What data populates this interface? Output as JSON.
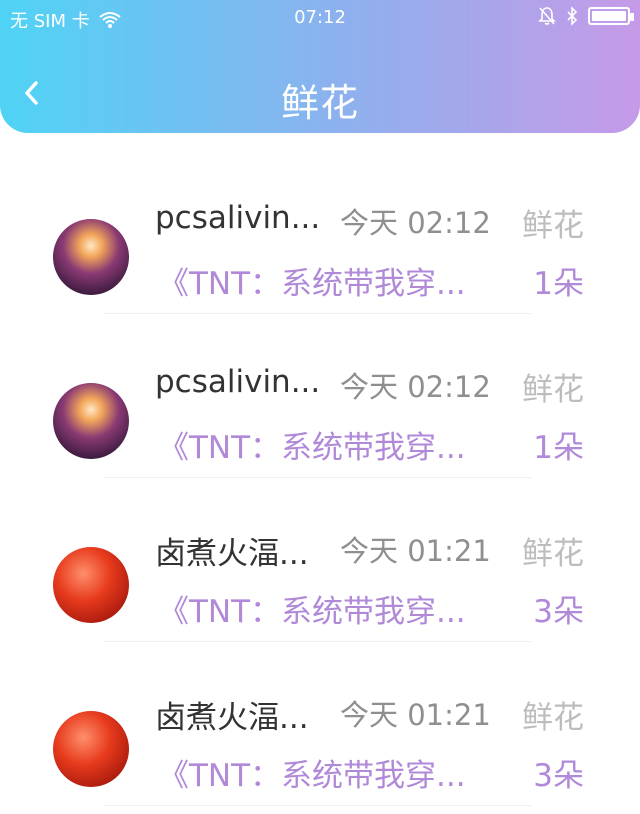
{
  "status_bar": {
    "carrier": "无 SIM 卡",
    "time": "07:12",
    "battery_level": 1.0,
    "icons": [
      "wifi-icon",
      "mute-bell-icon",
      "bluetooth-icon",
      "battery-icon"
    ]
  },
  "header": {
    "title": "鲜花",
    "back_icon": "back-chevron-icon",
    "gradient_colors": [
      "#4fd3f5",
      "#8fb0ee",
      "#c69ae8"
    ]
  },
  "items": [
    {
      "avatar": "avatar-a",
      "name": "pcsalivin...",
      "time": "今天 02:12",
      "kind": "鲜花",
      "book": "《TNT：系统带我穿...",
      "count": "1朵"
    },
    {
      "avatar": "avatar-a",
      "name": "pcsalivin...",
      "time": "今天 02:12",
      "kind": "鲜花",
      "book": "《TNT：系统带我穿...",
      "count": "1朵"
    },
    {
      "avatar": "avatar-b",
      "name": "卤煮火湢...",
      "time": "今天 01:21",
      "kind": "鲜花",
      "book": "《TNT：系统带我穿...",
      "count": "3朵"
    },
    {
      "avatar": "avatar-b",
      "name": "卤煮火湢...",
      "time": "今天 01:21",
      "kind": "鲜花",
      "book": "《TNT：系统带我穿...",
      "count": "3朵"
    }
  ],
  "colors": {
    "accent": "#b089d8",
    "muted": "#8f8f8f",
    "kind": "#bdbdbd",
    "name": "#333333"
  }
}
